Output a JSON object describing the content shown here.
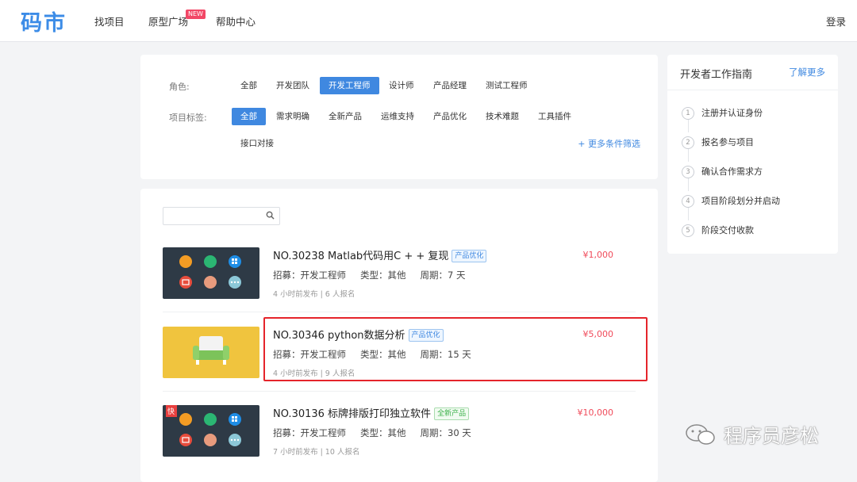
{
  "header": {
    "logo": "码市",
    "nav": [
      "找项目",
      "原型广场",
      "帮助中心"
    ],
    "new_badge": "NEW",
    "login": "登录"
  },
  "filter": {
    "role_label": "角色:",
    "roles": [
      "全部",
      "开发团队",
      "开发工程师",
      "设计师",
      "产品经理",
      "测试工程师"
    ],
    "tag_label": "项目标签:",
    "tags": [
      "全部",
      "需求明确",
      "全新产品",
      "运维支持",
      "产品优化",
      "技术难题",
      "工具插件",
      "接口对接"
    ],
    "more": "+ 更多条件筛选"
  },
  "search": {
    "placeholder": ""
  },
  "projects": [
    {
      "title": "NO.30238  Matlab代码用C + + 复现",
      "tag": "产品优化",
      "recruit": "招募：开发工程师",
      "type": "类型：其他",
      "period": "周期：7 天",
      "info": "4 小时前发布  |  6 人报名",
      "price": "¥1,000"
    },
    {
      "title": "NO.30346  python数据分析",
      "tag": "产品优化",
      "recruit": "招募：开发工程师",
      "type": "类型：其他",
      "period": "周期：15 天",
      "info": "4 小时前发布  |  9 人报名",
      "price": "¥5,000"
    },
    {
      "title": "NO.30136  标牌排版打印独立软件",
      "tag": "全新产品",
      "recruit": "招募：开发工程师",
      "type": "类型：其他",
      "period": "周期：30 天",
      "info": "7 小时前发布  |  10 人报名",
      "price": "¥10,000"
    }
  ],
  "thumb_badge": "快",
  "guide": {
    "title": "开发者工作指南",
    "more": "了解更多",
    "steps": [
      {
        "num": "1",
        "label": "注册并认证身份"
      },
      {
        "num": "2",
        "label": "报名参与项目"
      },
      {
        "num": "3",
        "label": "确认合作需求方"
      },
      {
        "num": "4",
        "label": "项目阶段划分并启动"
      },
      {
        "num": "5",
        "label": "阶段交付收款"
      }
    ]
  },
  "watermark": "程序员彦松",
  "colors": {
    "accent": "#3f88e0",
    "price": "#f04b5b",
    "highlight": "#e5242b"
  }
}
